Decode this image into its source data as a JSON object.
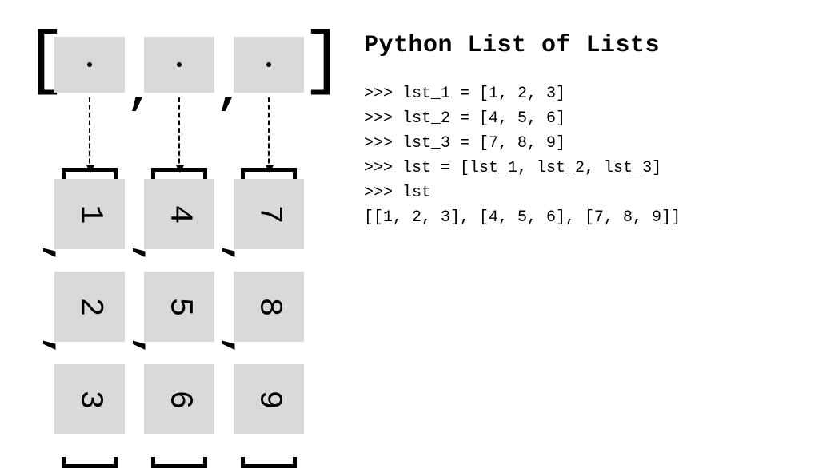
{
  "title": "Python List of Lists",
  "outer_list": {
    "count": 3,
    "commas": [
      ",",
      ","
    ]
  },
  "inner_lists": [
    {
      "values": [
        "1",
        "2",
        "3"
      ]
    },
    {
      "values": [
        "4",
        "5",
        "6"
      ]
    },
    {
      "values": [
        "7",
        "8",
        "9"
      ]
    }
  ],
  "code": {
    "prompt": ">>> ",
    "lines": [
      "lst_1 = [1, 2, 3]",
      "lst_2 = [4, 5, 6]",
      "lst_3 = [7, 8, 9]",
      "lst = [lst_1, lst_2, lst_3]",
      "lst"
    ],
    "output": "[[1, 2, 3], [4, 5, 6], [7, 8, 9]]"
  },
  "chart_data": {
    "type": "table",
    "title": "Python List of Lists",
    "structure": "list-of-lists",
    "outer": [
      "lst_1",
      "lst_2",
      "lst_3"
    ],
    "inner": [
      [
        1,
        2,
        3
      ],
      [
        4,
        5,
        6
      ],
      [
        7,
        8,
        9
      ]
    ]
  }
}
